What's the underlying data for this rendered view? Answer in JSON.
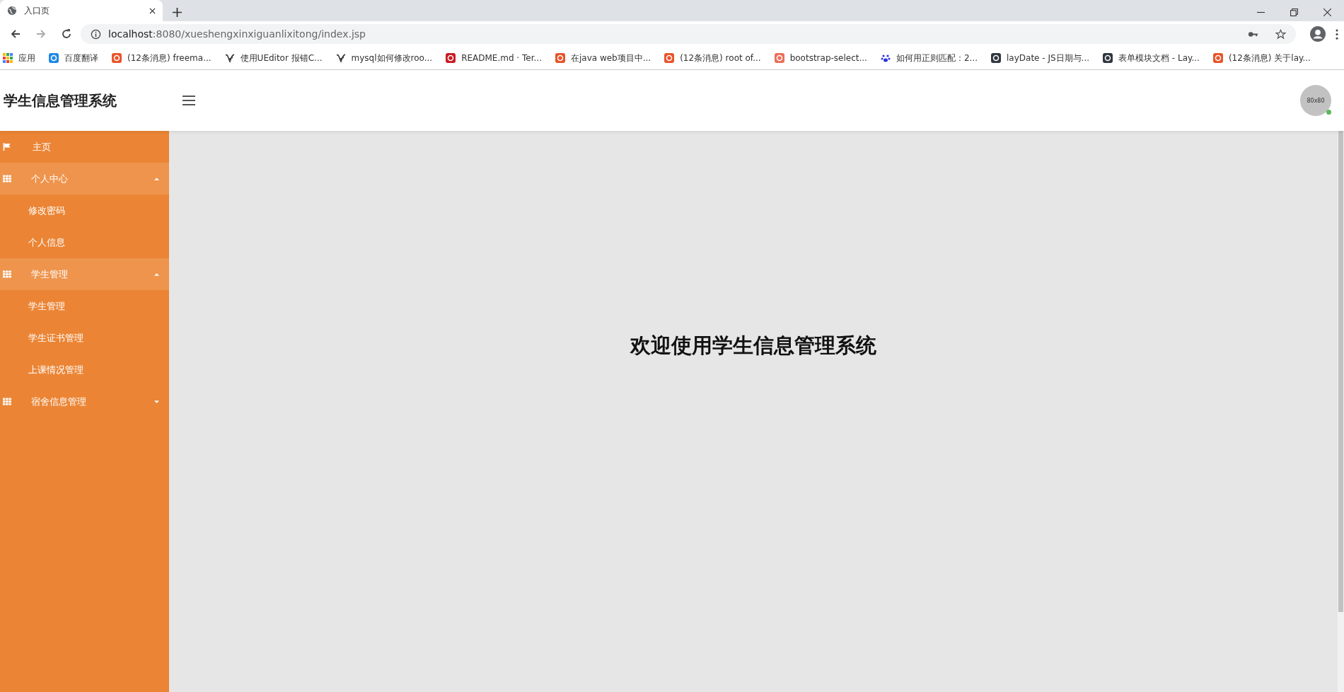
{
  "browser": {
    "tab_title": "入口页",
    "url_host": "localhost",
    "url_rest": ":8080/xueshengxinxiguanlixitong/index.jsp",
    "bookmarks": [
      {
        "kind": "apps",
        "label": "应用"
      },
      {
        "kind": "translate",
        "label": "百度翻译"
      },
      {
        "kind": "csdn",
        "label": "(12条消息) freema..."
      },
      {
        "kind": "ueditor",
        "label": "使用UEditor 报错C..."
      },
      {
        "kind": "ueditor",
        "label": "mysql如何修改roo..."
      },
      {
        "kind": "gitee",
        "label": "README.md · Ter..."
      },
      {
        "kind": "csdn",
        "label": "在java web项目中..."
      },
      {
        "kind": "csdn",
        "label": "(12条消息) root of..."
      },
      {
        "kind": "jianshu",
        "label": "bootstrap-select..."
      },
      {
        "kind": "baidu",
        "label": "如何用正则匹配：2..."
      },
      {
        "kind": "layui",
        "label": "layDate - JS日期与..."
      },
      {
        "kind": "layui",
        "label": "表单模块文档 - Lay..."
      },
      {
        "kind": "csdn",
        "label": "(12条消息) 关于lay..."
      }
    ]
  },
  "header": {
    "title": "学生信息管理系统",
    "avatar_text": "80x80",
    "online": true
  },
  "sidebar": [
    {
      "kind": "link",
      "label": "主页"
    },
    {
      "kind": "group",
      "label": "个人中心",
      "expanded": true,
      "children": [
        {
          "label": "修改密码"
        },
        {
          "label": "个人信息"
        }
      ]
    },
    {
      "kind": "group",
      "label": "学生管理",
      "expanded": true,
      "children": [
        {
          "label": "学生管理"
        },
        {
          "label": "学生证书管理"
        },
        {
          "label": "上课情况管理"
        }
      ]
    },
    {
      "kind": "group",
      "label": "宿舍信息管理",
      "expanded": false
    }
  ],
  "welcome": "欢迎使用学生信息管理系统"
}
